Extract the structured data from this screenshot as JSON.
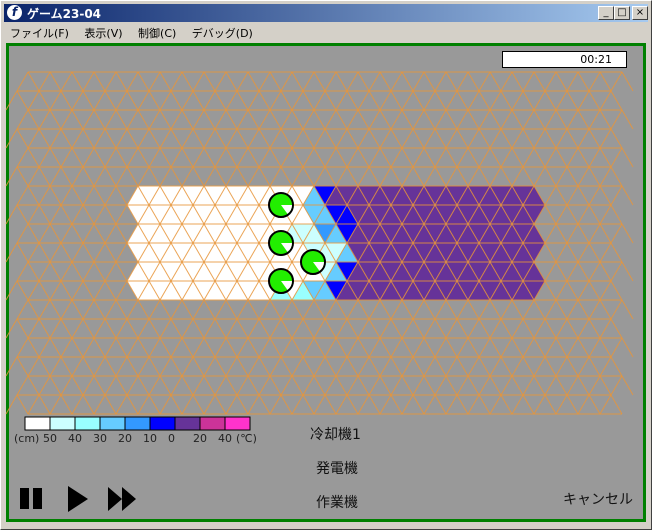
{
  "window": {
    "title": "ゲーム23-04",
    "minimize": "_",
    "maximize": "□",
    "close": "×"
  },
  "menu": [
    "ファイル(F)",
    "表示(V)",
    "制御(C)",
    "デバッグ(D)"
  ],
  "timer": "00:21",
  "colors": {
    "frame": "#008000",
    "grid": "#e8953a",
    "background": "#999999",
    "unit": "#22ee00"
  },
  "legend": {
    "unit_left": "(cm)",
    "unit_right": "(℃)",
    "ticks": [
      "50",
      "40",
      "30",
      "20",
      "10",
      "0",
      "20",
      "40"
    ],
    "swatches": [
      "#ffffff",
      "#ccffff",
      "#99ffff",
      "#66ccff",
      "#3399ff",
      "#0000ff",
      "#663399",
      "#cc3399",
      "#ff33cc"
    ]
  },
  "field": {
    "rows": 18,
    "colored_rows_start": 6,
    "colored": [
      {
        "white_until": 16,
        "transition": [
          "#66ccff",
          "#0000ff"
        ],
        "rest": "#663399"
      },
      {
        "white_until": 16,
        "transition": [
          "#66ccff",
          "#66ccff",
          "#0000ff",
          "#0000ff"
        ],
        "rest": "#663399"
      },
      {
        "white_until": 14,
        "transition": [
          "#ccffff",
          "#ccffff",
          "#ccffff",
          "#3399ff",
          "#66ccff",
          "#0000ff"
        ],
        "rest": "#663399"
      },
      {
        "white_until": 16,
        "transition": [
          "#ccffff",
          "#ccffff",
          "#ccffff",
          "#66ccff"
        ],
        "rest": "#663399"
      },
      {
        "white_until": 17,
        "transition": [
          "#ccffff",
          "#66ccff",
          "#0000ff"
        ],
        "rest": "#663399"
      },
      {
        "white_until": 13,
        "transition": [
          "#99ffff",
          "#ffffff",
          "#99ffff",
          "#66ccff",
          "#66ccff",
          "#0000ff"
        ],
        "rest": "#663399"
      }
    ],
    "units": [
      {
        "name": "unit-1",
        "progress": 0.15
      },
      {
        "name": "unit-2",
        "progress": 0.15
      },
      {
        "name": "unit-3",
        "progress": 0.15
      },
      {
        "name": "unit-4",
        "progress": 0.15
      }
    ]
  },
  "buttons": {
    "cooler": "冷却機1",
    "generator": "発電機",
    "worker": "作業機",
    "cancel": "キャンセル"
  },
  "controls": [
    "pause",
    "play",
    "fast-forward"
  ]
}
